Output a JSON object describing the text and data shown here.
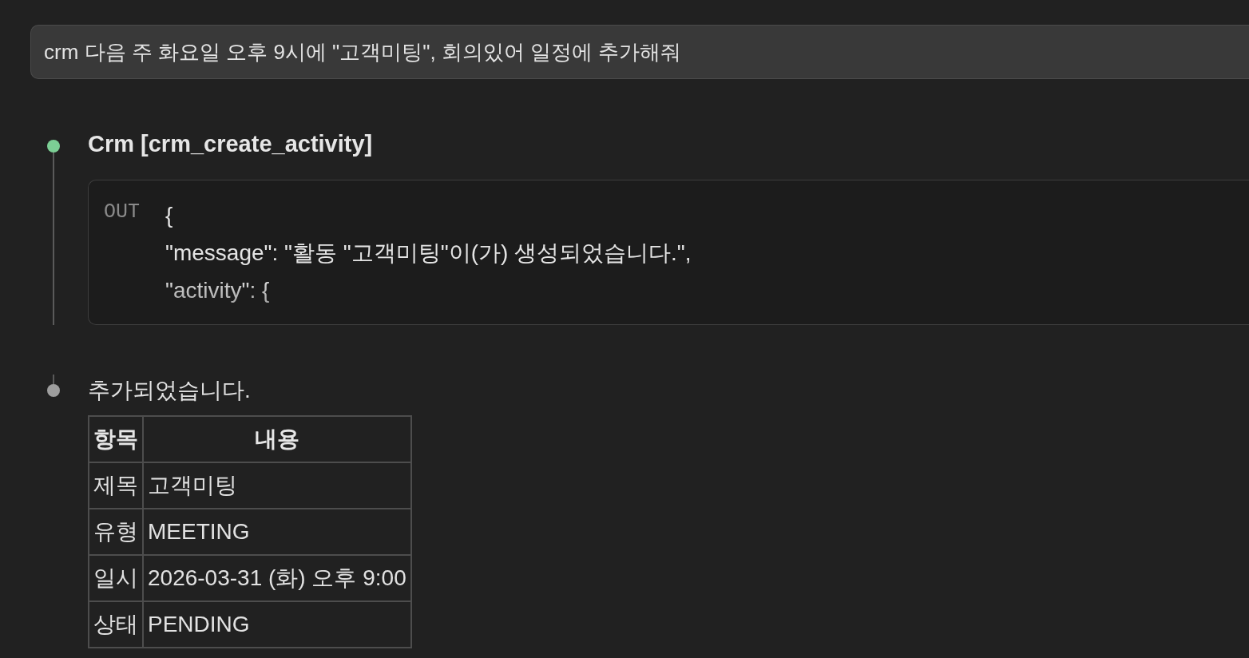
{
  "prompt": {
    "text": "crm 다음 주 화요일 오후 9시에 \"고객미팅\", 회의있어 일정에 추가해줘"
  },
  "timeline": [
    {
      "kind": "tool_call",
      "color": "#7ccf95",
      "title": "Crm [crm_create_activity]",
      "output": {
        "label": "OUT",
        "lines": [
          "{",
          "\"message\": \"활동 \"고객미팅\"이(가) 생성되었습니다.\",",
          "\"activity\": {"
        ]
      }
    },
    {
      "kind": "reply",
      "color": "#9e9e9e",
      "text": "추가되었습니다.",
      "table": {
        "columns": [
          "항목",
          "내용"
        ],
        "rows": [
          [
            "제목",
            "고객미팅"
          ],
          [
            "유형",
            "MEETING"
          ],
          [
            "일시",
            "2026-03-31 (화) 오후 9:00"
          ],
          [
            "상태",
            "PENDING"
          ]
        ]
      }
    }
  ]
}
